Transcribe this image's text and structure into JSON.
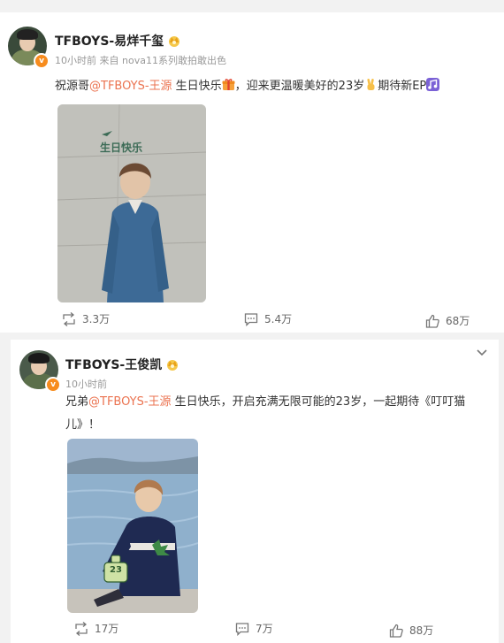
{
  "posts": [
    {
      "author": "TFBOYS-易烊千玺",
      "meta": "10小时前 来自 nova11系列敢拍敢出色",
      "text_prefix": "祝源哥",
      "mention": "@TFBOYS-王源",
      "text_mid": " 生日快乐",
      "text_after_gift": "，迎来更温暖美好的23岁",
      "text_after_hand": "期待新EP",
      "image_caption": "生日快乐",
      "reposts": "3.3万",
      "comments": "5.4万",
      "likes": "68万"
    },
    {
      "author": "TFBOYS-王俊凯",
      "meta": "10小时前",
      "text_prefix": "兄弟",
      "mention": "@TFBOYS-王源",
      "text_line1_rest": " 生日快乐，开启充满无限可能的23岁，一起期待《叮叮猫",
      "text_line2": "儿》！",
      "image_badge": "23",
      "reposts": "17万",
      "comments": "7万",
      "likes": "88万"
    }
  ],
  "icons": [
    "verified-badge",
    "crown-badge-icon",
    "gift-emoji",
    "victory-hand-emoji",
    "music-note-emoji",
    "repost-icon",
    "comment-icon",
    "like-icon",
    "chevron-down-icon"
  ],
  "colors": {
    "mention": "#eb7350",
    "badge": "#f78c1e",
    "meta": "#999999"
  }
}
